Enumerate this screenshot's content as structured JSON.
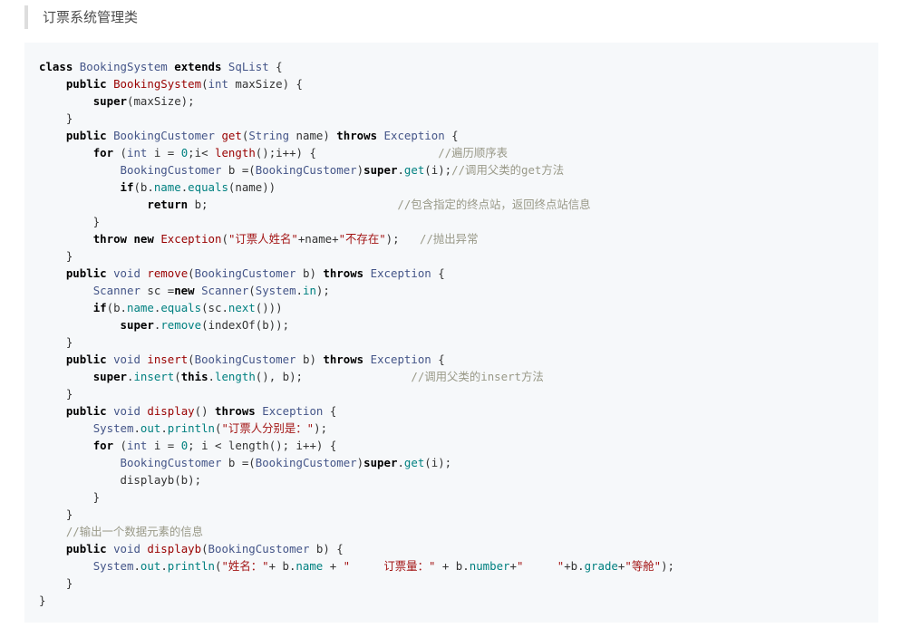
{
  "heading": "订票系统管理类",
  "colors": {
    "keyword": "#000000",
    "type": "#445588",
    "function": "#990000",
    "string": "#a31515",
    "number": "#008080",
    "comment": "#999988",
    "property": "#008080",
    "plain": "#333333",
    "code_background": "#f6f8fa",
    "heading_border": "#dddddd"
  },
  "code": [
    [
      [
        "kw",
        "class"
      ],
      [
        "p",
        " "
      ],
      [
        "type",
        "BookingSystem"
      ],
      [
        "p",
        " "
      ],
      [
        "kw",
        "extends"
      ],
      [
        "p",
        " "
      ],
      [
        "type",
        "SqList"
      ],
      [
        "p",
        " {"
      ]
    ],
    [
      [
        "p",
        "    "
      ],
      [
        "kw",
        "public"
      ],
      [
        "p",
        " "
      ],
      [
        "fn",
        "BookingSystem"
      ],
      [
        "p",
        "("
      ],
      [
        "type",
        "int"
      ],
      [
        "p",
        " maxSize) {"
      ]
    ],
    [
      [
        "p",
        "        "
      ],
      [
        "kw",
        "super"
      ],
      [
        "p",
        "(maxSize);"
      ]
    ],
    [
      [
        "p",
        "    }"
      ]
    ],
    [
      [
        "p",
        "    "
      ],
      [
        "kw",
        "public"
      ],
      [
        "p",
        " "
      ],
      [
        "type",
        "BookingCustomer"
      ],
      [
        "p",
        " "
      ],
      [
        "fn",
        "get"
      ],
      [
        "p",
        "("
      ],
      [
        "type",
        "String"
      ],
      [
        "p",
        " name) "
      ],
      [
        "kw",
        "throws"
      ],
      [
        "p",
        " "
      ],
      [
        "type",
        "Exception"
      ],
      [
        "p",
        " {"
      ]
    ],
    [
      [
        "p",
        "        "
      ],
      [
        "kw",
        "for"
      ],
      [
        "p",
        " ("
      ],
      [
        "type",
        "int"
      ],
      [
        "p",
        " i = "
      ],
      [
        "num",
        "0"
      ],
      [
        "p",
        ";i< "
      ],
      [
        "fn",
        "length"
      ],
      [
        "p",
        "();i++) {                  "
      ],
      [
        "cm",
        "//遍历顺序表"
      ]
    ],
    [
      [
        "p",
        "            "
      ],
      [
        "type",
        "BookingCustomer"
      ],
      [
        "p",
        " b =("
      ],
      [
        "type",
        "BookingCustomer"
      ],
      [
        "p",
        ")"
      ],
      [
        "kw",
        "super"
      ],
      [
        "p",
        "."
      ],
      [
        "prop",
        "get"
      ],
      [
        "p",
        "(i);"
      ],
      [
        "cm",
        "//调用父类的get方法"
      ]
    ],
    [
      [
        "p",
        "            "
      ],
      [
        "kw",
        "if"
      ],
      [
        "p",
        "(b."
      ],
      [
        "prop",
        "name"
      ],
      [
        "p",
        "."
      ],
      [
        "prop",
        "equals"
      ],
      [
        "p",
        "(name))"
      ]
    ],
    [
      [
        "p",
        "                "
      ],
      [
        "kw",
        "return"
      ],
      [
        "p",
        " b;                            "
      ],
      [
        "cm",
        "//包含指定的终点站，返回终点站信息"
      ]
    ],
    [
      [
        "p",
        "        }"
      ]
    ],
    [
      [
        "p",
        "        "
      ],
      [
        "kw",
        "throw"
      ],
      [
        "p",
        " "
      ],
      [
        "kw",
        "new"
      ],
      [
        "p",
        " "
      ],
      [
        "fn",
        "Exception"
      ],
      [
        "p",
        "("
      ],
      [
        "str",
        "\"订票人姓名\""
      ],
      [
        "p",
        "+name+"
      ],
      [
        "str",
        "\"不存在\""
      ],
      [
        "p",
        ");   "
      ],
      [
        "cm",
        "//抛出异常"
      ]
    ],
    [
      [
        "p",
        "    }"
      ]
    ],
    [
      [
        "p",
        "    "
      ],
      [
        "kw",
        "public"
      ],
      [
        "p",
        " "
      ],
      [
        "type",
        "void"
      ],
      [
        "p",
        " "
      ],
      [
        "fn",
        "remove"
      ],
      [
        "p",
        "("
      ],
      [
        "type",
        "BookingCustomer"
      ],
      [
        "p",
        " b) "
      ],
      [
        "kw",
        "throws"
      ],
      [
        "p",
        " "
      ],
      [
        "type",
        "Exception"
      ],
      [
        "p",
        " {"
      ]
    ],
    [
      [
        "p",
        "        "
      ],
      [
        "type",
        "Scanner"
      ],
      [
        "p",
        " sc ="
      ],
      [
        "kw",
        "new"
      ],
      [
        "p",
        " "
      ],
      [
        "type",
        "Scanner"
      ],
      [
        "p",
        "("
      ],
      [
        "type",
        "System"
      ],
      [
        "p",
        "."
      ],
      [
        "prop",
        "in"
      ],
      [
        "p",
        ");"
      ]
    ],
    [
      [
        "p",
        "        "
      ],
      [
        "kw",
        "if"
      ],
      [
        "p",
        "(b."
      ],
      [
        "prop",
        "name"
      ],
      [
        "p",
        "."
      ],
      [
        "prop",
        "equals"
      ],
      [
        "p",
        "(sc."
      ],
      [
        "prop",
        "next"
      ],
      [
        "p",
        "()))"
      ]
    ],
    [
      [
        "p",
        "            "
      ],
      [
        "kw",
        "super"
      ],
      [
        "p",
        "."
      ],
      [
        "prop",
        "remove"
      ],
      [
        "p",
        "(indexOf(b));"
      ]
    ],
    [
      [
        "p",
        "    }"
      ]
    ],
    [
      [
        "p",
        "    "
      ],
      [
        "kw",
        "public"
      ],
      [
        "p",
        " "
      ],
      [
        "type",
        "void"
      ],
      [
        "p",
        " "
      ],
      [
        "fn",
        "insert"
      ],
      [
        "p",
        "("
      ],
      [
        "type",
        "BookingCustomer"
      ],
      [
        "p",
        " b) "
      ],
      [
        "kw",
        "throws"
      ],
      [
        "p",
        " "
      ],
      [
        "type",
        "Exception"
      ],
      [
        "p",
        " {"
      ]
    ],
    [
      [
        "p",
        "        "
      ],
      [
        "kw",
        "super"
      ],
      [
        "p",
        "."
      ],
      [
        "prop",
        "insert"
      ],
      [
        "p",
        "("
      ],
      [
        "kw",
        "this"
      ],
      [
        "p",
        "."
      ],
      [
        "prop",
        "length"
      ],
      [
        "p",
        "(), b);                "
      ],
      [
        "cm",
        "//调用父类的insert方法"
      ]
    ],
    [
      [
        "p",
        "    }"
      ]
    ],
    [
      [
        "p",
        "    "
      ],
      [
        "kw",
        "public"
      ],
      [
        "p",
        " "
      ],
      [
        "type",
        "void"
      ],
      [
        "p",
        " "
      ],
      [
        "fn",
        "display"
      ],
      [
        "p",
        "() "
      ],
      [
        "kw",
        "throws"
      ],
      [
        "p",
        " "
      ],
      [
        "type",
        "Exception"
      ],
      [
        "p",
        " {"
      ]
    ],
    [
      [
        "p",
        "        "
      ],
      [
        "type",
        "System"
      ],
      [
        "p",
        "."
      ],
      [
        "prop",
        "out"
      ],
      [
        "p",
        "."
      ],
      [
        "prop",
        "println"
      ],
      [
        "p",
        "("
      ],
      [
        "str",
        "\"订票人分别是：\""
      ],
      [
        "p",
        ");"
      ]
    ],
    [
      [
        "p",
        "        "
      ],
      [
        "kw",
        "for"
      ],
      [
        "p",
        " ("
      ],
      [
        "type",
        "int"
      ],
      [
        "p",
        " i = "
      ],
      [
        "num",
        "0"
      ],
      [
        "p",
        "; i < length(); i++) {"
      ]
    ],
    [
      [
        "p",
        "            "
      ],
      [
        "type",
        "BookingCustomer"
      ],
      [
        "p",
        " b =("
      ],
      [
        "type",
        "BookingCustomer"
      ],
      [
        "p",
        ")"
      ],
      [
        "kw",
        "super"
      ],
      [
        "p",
        "."
      ],
      [
        "prop",
        "get"
      ],
      [
        "p",
        "(i);"
      ]
    ],
    [
      [
        "p",
        "            displayb(b);"
      ]
    ],
    [
      [
        "p",
        "        }"
      ]
    ],
    [
      [
        "p",
        "    }"
      ]
    ],
    [
      [
        "p",
        "    "
      ],
      [
        "cm",
        "//输出一个数据元素的信息"
      ]
    ],
    [
      [
        "p",
        "    "
      ],
      [
        "kw",
        "public"
      ],
      [
        "p",
        " "
      ],
      [
        "type",
        "void"
      ],
      [
        "p",
        " "
      ],
      [
        "fn",
        "displayb"
      ],
      [
        "p",
        "("
      ],
      [
        "type",
        "BookingCustomer"
      ],
      [
        "p",
        " b) {"
      ]
    ],
    [
      [
        "p",
        "        "
      ],
      [
        "type",
        "System"
      ],
      [
        "p",
        "."
      ],
      [
        "prop",
        "out"
      ],
      [
        "p",
        "."
      ],
      [
        "prop",
        "println"
      ],
      [
        "p",
        "("
      ],
      [
        "str",
        "\"姓名：\""
      ],
      [
        "p",
        "+ b."
      ],
      [
        "prop",
        "name"
      ],
      [
        "p",
        " + "
      ],
      [
        "str",
        "\"     订票量：\""
      ],
      [
        "p",
        " + b."
      ],
      [
        "prop",
        "number"
      ],
      [
        "p",
        "+"
      ],
      [
        "str",
        "\"     \""
      ],
      [
        "p",
        "+b."
      ],
      [
        "prop",
        "grade"
      ],
      [
        "p",
        "+"
      ],
      [
        "str",
        "\"等舱\""
      ],
      [
        "p",
        ");"
      ]
    ],
    [
      [
        "p",
        "    }"
      ]
    ],
    [
      [
        "p",
        "}"
      ]
    ]
  ]
}
